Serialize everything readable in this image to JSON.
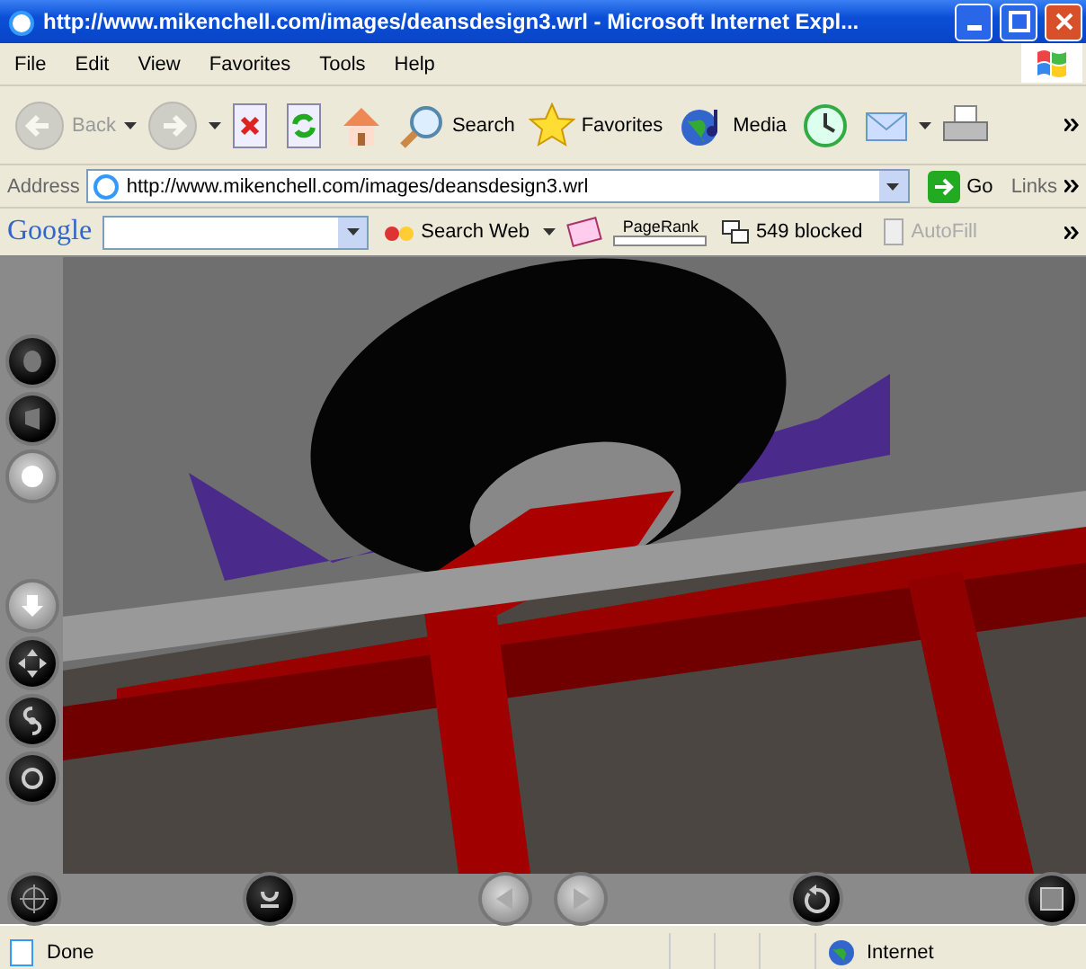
{
  "window": {
    "title": "http://www.mikenchell.com/images/deansdesign3.wrl - Microsoft Internet Expl..."
  },
  "menu": [
    "File",
    "Edit",
    "View",
    "Favorites",
    "Tools",
    "Help"
  ],
  "toolbar": [
    {
      "kind": "back",
      "label": "Back",
      "disabled": true,
      "dropdown": true
    },
    {
      "kind": "forward",
      "disabled": true,
      "dropdown": true
    },
    {
      "kind": "stop",
      "disabled": false
    },
    {
      "kind": "refresh",
      "disabled": false
    },
    {
      "kind": "home",
      "disabled": false
    },
    {
      "kind": "search",
      "label": "Search",
      "disabled": false
    },
    {
      "kind": "favorites",
      "label": "Favorites",
      "disabled": false
    },
    {
      "kind": "media",
      "label": "Media",
      "disabled": false
    },
    {
      "kind": "history",
      "disabled": false
    },
    {
      "kind": "mail",
      "disabled": false,
      "dropdown": true
    },
    {
      "kind": "print",
      "disabled": false
    }
  ],
  "address_bar": {
    "label": "Address",
    "url": "http://www.mikenchell.com/images/deansdesign3.wrl",
    "go": "Go",
    "links": "Links"
  },
  "google_bar": {
    "logo": "Google",
    "search_button": "Search Web",
    "pagerank": "PageRank",
    "blocked": "549 blocked",
    "autofill": {
      "label": "AutoFill",
      "disabled": true
    }
  },
  "player": {
    "side_controls": [
      {
        "kind": "walk",
        "disabled": false
      },
      {
        "kind": "fly",
        "disabled": false
      },
      {
        "kind": "study",
        "disabled": true
      },
      {
        "kind": "down",
        "disabled": true
      },
      {
        "kind": "pan",
        "disabled": false
      },
      {
        "kind": "turn",
        "disabled": false
      },
      {
        "kind": "roll",
        "disabled": false
      }
    ],
    "bottom_controls": [
      {
        "kind": "goto",
        "disabled": false
      },
      {
        "kind": "align",
        "disabled": false
      },
      {
        "kind": "prev",
        "disabled": true
      },
      {
        "kind": "next",
        "disabled": true
      },
      {
        "kind": "restore",
        "disabled": false
      },
      {
        "kind": "fit",
        "disabled": false
      }
    ]
  },
  "status_bar": {
    "text": "Done",
    "zone": "Internet"
  }
}
